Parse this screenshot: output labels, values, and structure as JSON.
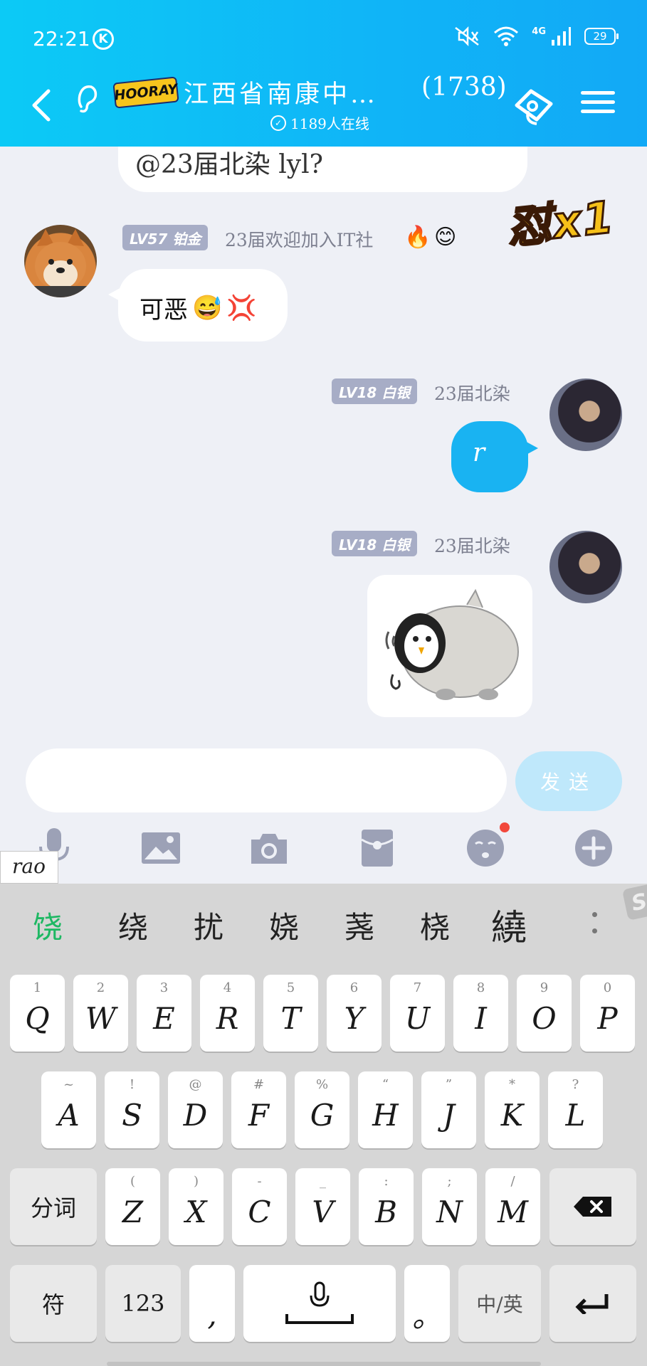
{
  "status_bar": {
    "time": "22:21",
    "k_badge": "K",
    "network": "4G",
    "battery": "29"
  },
  "header": {
    "logo_text": "HOORAY",
    "group_name": "江西省南康中…",
    "member_count": "(1738)",
    "online_text": "1189人在线"
  },
  "chat": {
    "top_partial_text": "@23届北染 lyl?",
    "combo_text": "怼x1",
    "messages": [
      {
        "side": "left",
        "level": "LV57 铂金",
        "sender": "23届欢迎加入IT社",
        "text": "可恶",
        "emoji": [
          "😅",
          "💢"
        ]
      },
      {
        "side": "right",
        "level": "LV18 白银",
        "sender": "23届北染",
        "text": "r"
      },
      {
        "side": "right",
        "level": "LV18 白银",
        "sender": "23届北染",
        "type": "sticker"
      }
    ],
    "decorations": [
      "🔥",
      "😊"
    ]
  },
  "input": {
    "value": "",
    "placeholder": "",
    "send_label": "发送"
  },
  "toolbar": {
    "icons": [
      "microphone-icon",
      "image-icon",
      "camera-icon",
      "red-packet-icon",
      "emoji-icon",
      "plus-icon"
    ],
    "emoji_has_dot": true
  },
  "ime": {
    "pinyin": "rao",
    "candidates": [
      "饶",
      "绕",
      "扰",
      "娆",
      "荛",
      "桡",
      "繞"
    ],
    "row1": [
      {
        "k": "Q",
        "h": "1"
      },
      {
        "k": "W",
        "h": "2"
      },
      {
        "k": "E",
        "h": "3"
      },
      {
        "k": "R",
        "h": "4"
      },
      {
        "k": "T",
        "h": "5"
      },
      {
        "k": "Y",
        "h": "6"
      },
      {
        "k": "U",
        "h": "7"
      },
      {
        "k": "I",
        "h": "8"
      },
      {
        "k": "O",
        "h": "9"
      },
      {
        "k": "P",
        "h": "0"
      }
    ],
    "row2": [
      {
        "k": "A",
        "h": "~"
      },
      {
        "k": "S",
        "h": "!"
      },
      {
        "k": "D",
        "h": "@"
      },
      {
        "k": "F",
        "h": "#"
      },
      {
        "k": "G",
        "h": "%"
      },
      {
        "k": "H",
        "h": "“"
      },
      {
        "k": "J",
        "h": "”"
      },
      {
        "k": "K",
        "h": "*"
      },
      {
        "k": "L",
        "h": "?"
      }
    ],
    "row3": [
      {
        "k": "Z",
        "h": "("
      },
      {
        "k": "X",
        "h": ")"
      },
      {
        "k": "C",
        "h": "-"
      },
      {
        "k": "V",
        "h": "_"
      },
      {
        "k": "B",
        "h": ":"
      },
      {
        "k": "N",
        "h": ";"
      },
      {
        "k": "M",
        "h": "/"
      }
    ],
    "segment_label": "分词",
    "symbol_label": "符",
    "numeric_label": "123",
    "comma_label": ",",
    "period_label": "。",
    "lang_label": "中/英"
  }
}
